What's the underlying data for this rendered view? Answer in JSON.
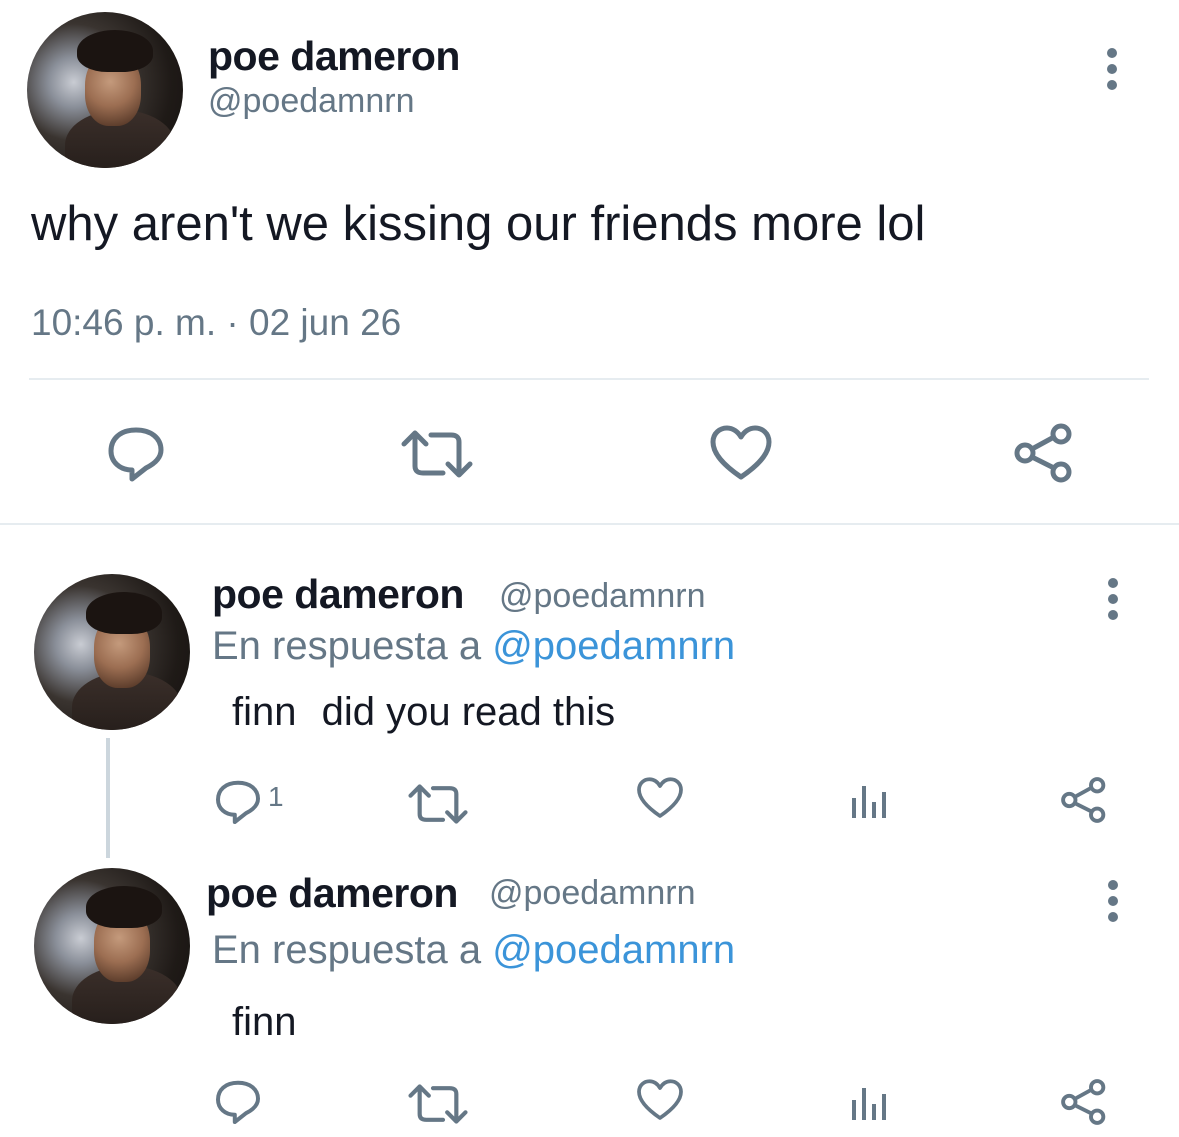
{
  "main_tweet": {
    "name": "poe dameron",
    "handle": "@poedamnrn",
    "text": "why aren't we kissing our friends more lol",
    "timestamp": "10:46 p. m. · 02 jun 26",
    "actions": [
      "reply-icon",
      "retweet-icon",
      "like-icon",
      "share-icon"
    ]
  },
  "replies": [
    {
      "name": "poe dameron",
      "handle": "@poedamnrn",
      "in_reply_prefix": "En respuesta a",
      "in_reply_handle": "@poedamnrn",
      "text_1": "finn",
      "text_2": "did you read this",
      "reply_count": "1"
    },
    {
      "name": "poe dameron",
      "handle": "@poedamnrn",
      "in_reply_prefix": "En respuesta a",
      "in_reply_handle": "@poedamnrn",
      "text_1": "finn",
      "text_2": "",
      "reply_count": ""
    }
  ],
  "colors": {
    "icon": "#657786",
    "link": "#3b94d9",
    "text": "#141823",
    "divider": "#e6ecf0"
  }
}
